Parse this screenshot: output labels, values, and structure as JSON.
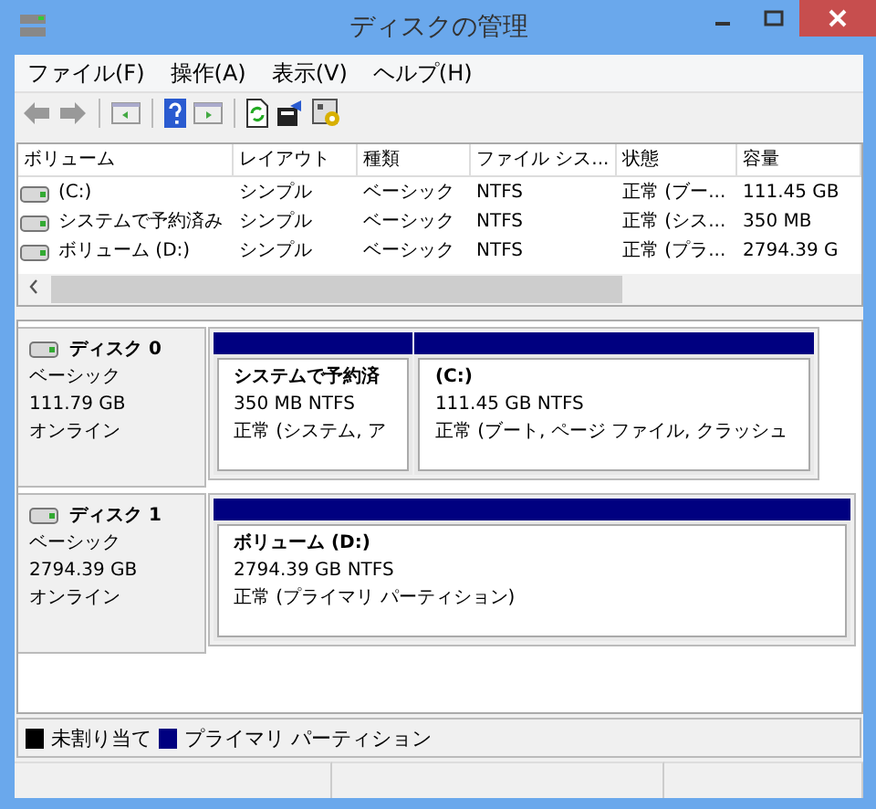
{
  "window": {
    "title": "ディスクの管理"
  },
  "menu": [
    {
      "label": "ファイル(F)"
    },
    {
      "label": "操作(A)"
    },
    {
      "label": "表示(V)"
    },
    {
      "label": "ヘルプ(H)"
    }
  ],
  "volume_list": {
    "columns": [
      "ボリューム",
      "レイアウト",
      "種類",
      "ファイル シス...",
      "状態",
      "容量"
    ],
    "rows": [
      {
        "cells": [
          "(C:)",
          "シンプル",
          "ベーシック",
          "NTFS",
          "正常 (ブー...",
          "111.45 GB"
        ]
      },
      {
        "cells": [
          "システムで予約済み",
          "シンプル",
          "ベーシック",
          "NTFS",
          "正常 (シス...",
          "350 MB"
        ]
      },
      {
        "cells": [
          "ボリューム (D:)",
          "シンプル",
          "ベーシック",
          "NTFS",
          "正常 (プラ...",
          "2794.39 G"
        ]
      }
    ]
  },
  "disks": [
    {
      "name": "ディスク 0",
      "type": "ベーシック",
      "size": "111.79 GB",
      "status": "オンライン",
      "partitions": [
        {
          "name": "システムで予約済",
          "detail": "350 MB NTFS",
          "status": "正常 (システム, ア"
        },
        {
          "name": "(C:)",
          "detail": "111.45 GB NTFS",
          "status": "正常 (ブート, ページ ファイル, クラッシュ"
        }
      ]
    },
    {
      "name": "ディスク 1",
      "type": "ベーシック",
      "size": "2794.39 GB",
      "status": "オンライン",
      "partitions": [
        {
          "name": "ボリューム (D:)",
          "detail": "2794.39 GB NTFS",
          "status": "正常 (プライマリ パーティション)"
        }
      ]
    }
  ],
  "legend": [
    {
      "label": "未割り当て",
      "color": "#000000"
    },
    {
      "label": "プライマリ パーティション",
      "color": "#000080"
    }
  ]
}
